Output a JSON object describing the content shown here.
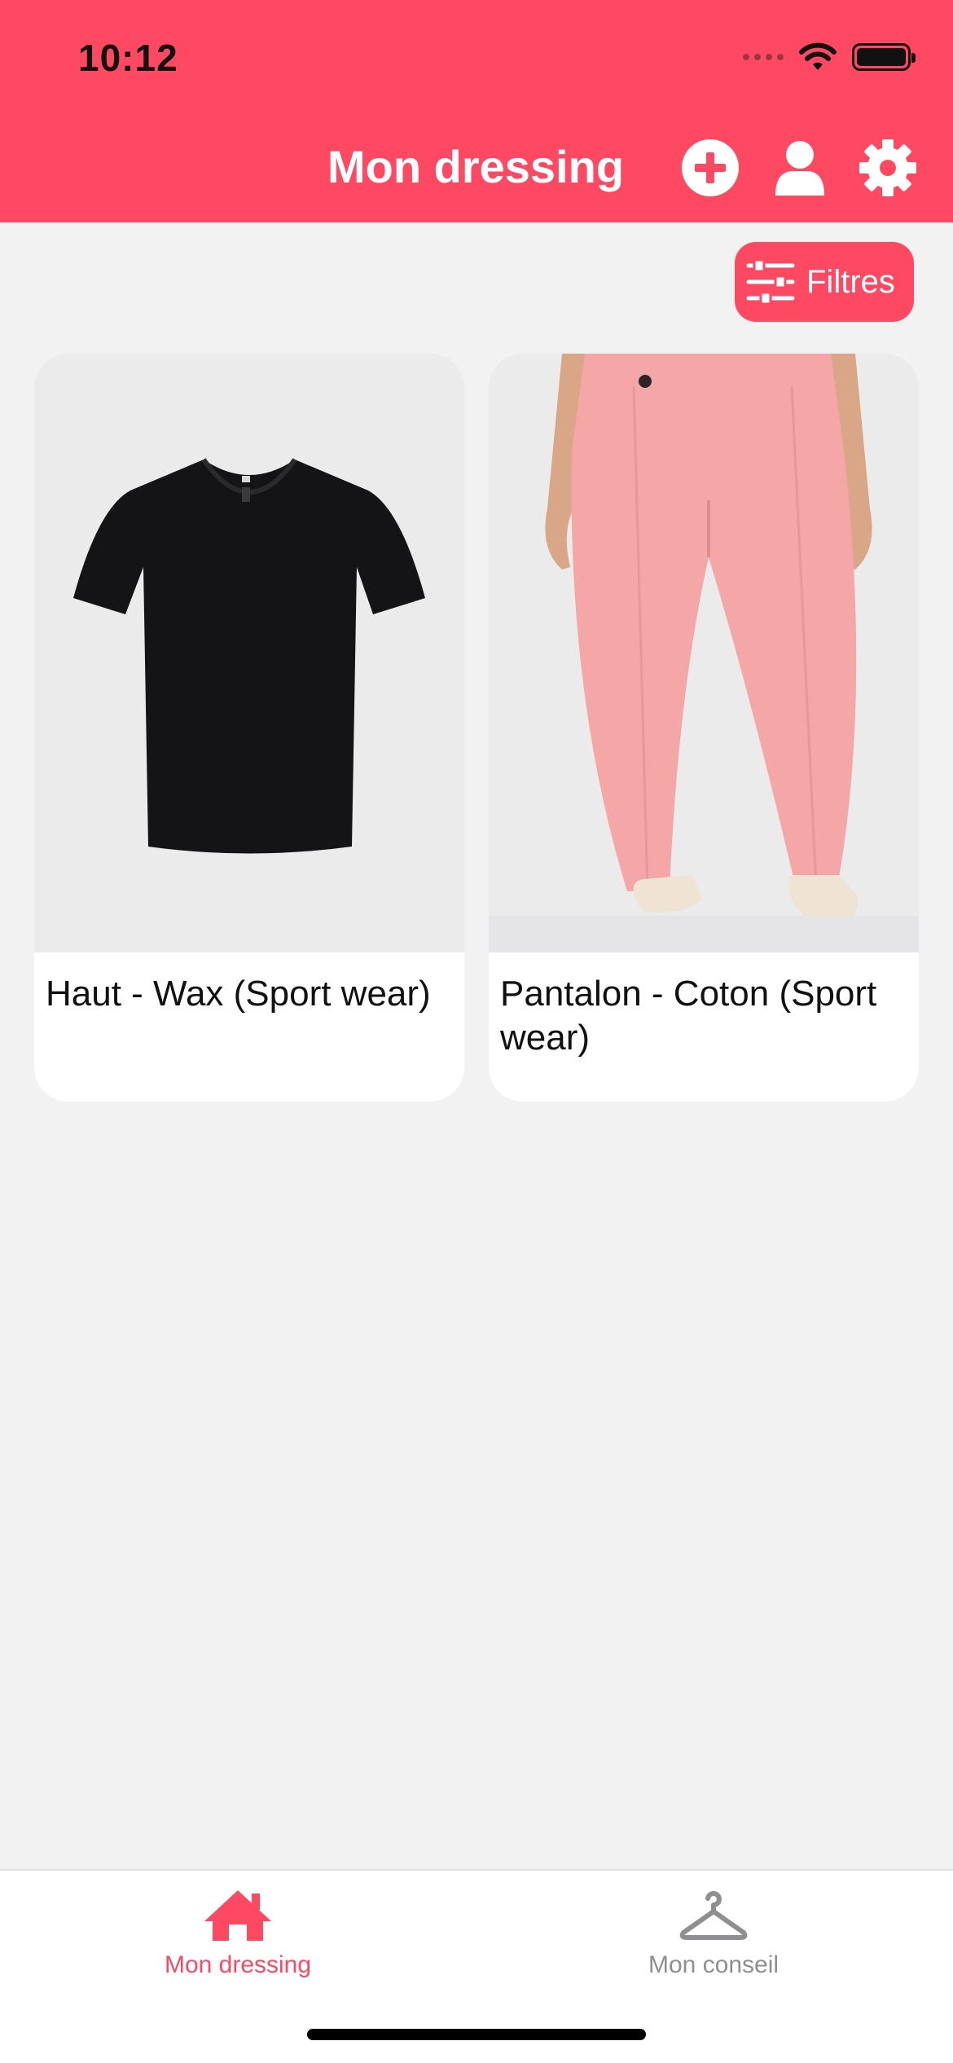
{
  "status_bar": {
    "time": "10:12"
  },
  "header": {
    "title": "Mon dressing",
    "background": "#ff4963",
    "icons": [
      "plus-circle-icon",
      "user-icon",
      "gear-icon"
    ]
  },
  "filters": {
    "label": "Filtres",
    "icon": "sliders-icon"
  },
  "items": [
    {
      "label": "Haut - Wax (Sport wear)"
    },
    {
      "label": "Pantalon - Coton (Sport wear)"
    }
  ],
  "tabbar": {
    "tabs": [
      {
        "label": "Mon dressing",
        "icon": "home-icon",
        "active": true,
        "color": "#ff4963"
      },
      {
        "label": "Mon conseil",
        "icon": "hanger-icon",
        "active": false,
        "color": "#8e8e93"
      }
    ]
  }
}
